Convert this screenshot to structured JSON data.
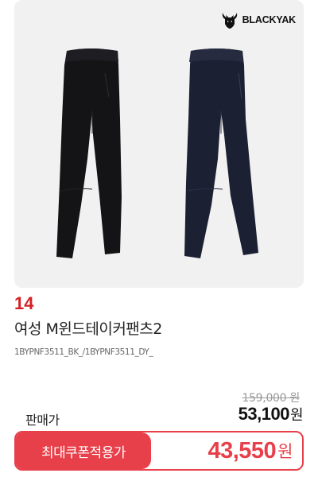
{
  "brand": {
    "logo_text": "BLACKYAK"
  },
  "product": {
    "rank": "14",
    "name": "여성 M윈드테이커팬츠2",
    "code": "1BYPNF3511_BK_/1BYPNF3511_DY_",
    "image_items": [
      "black-pants",
      "navy-pants"
    ]
  },
  "pricing": {
    "original_price": "159,000 원",
    "sale_label": "판매가",
    "sale_price": "53,100",
    "sale_unit": "원",
    "coupon_label": "최대쿠폰적용가",
    "coupon_price": "43,550",
    "coupon_unit": "원"
  },
  "colors": {
    "accent_red": "#e8404a",
    "rank_red": "#d61f25",
    "image_bg": "#f1f1f1",
    "pants_black": "#141416",
    "pants_navy": "#1c2033"
  }
}
